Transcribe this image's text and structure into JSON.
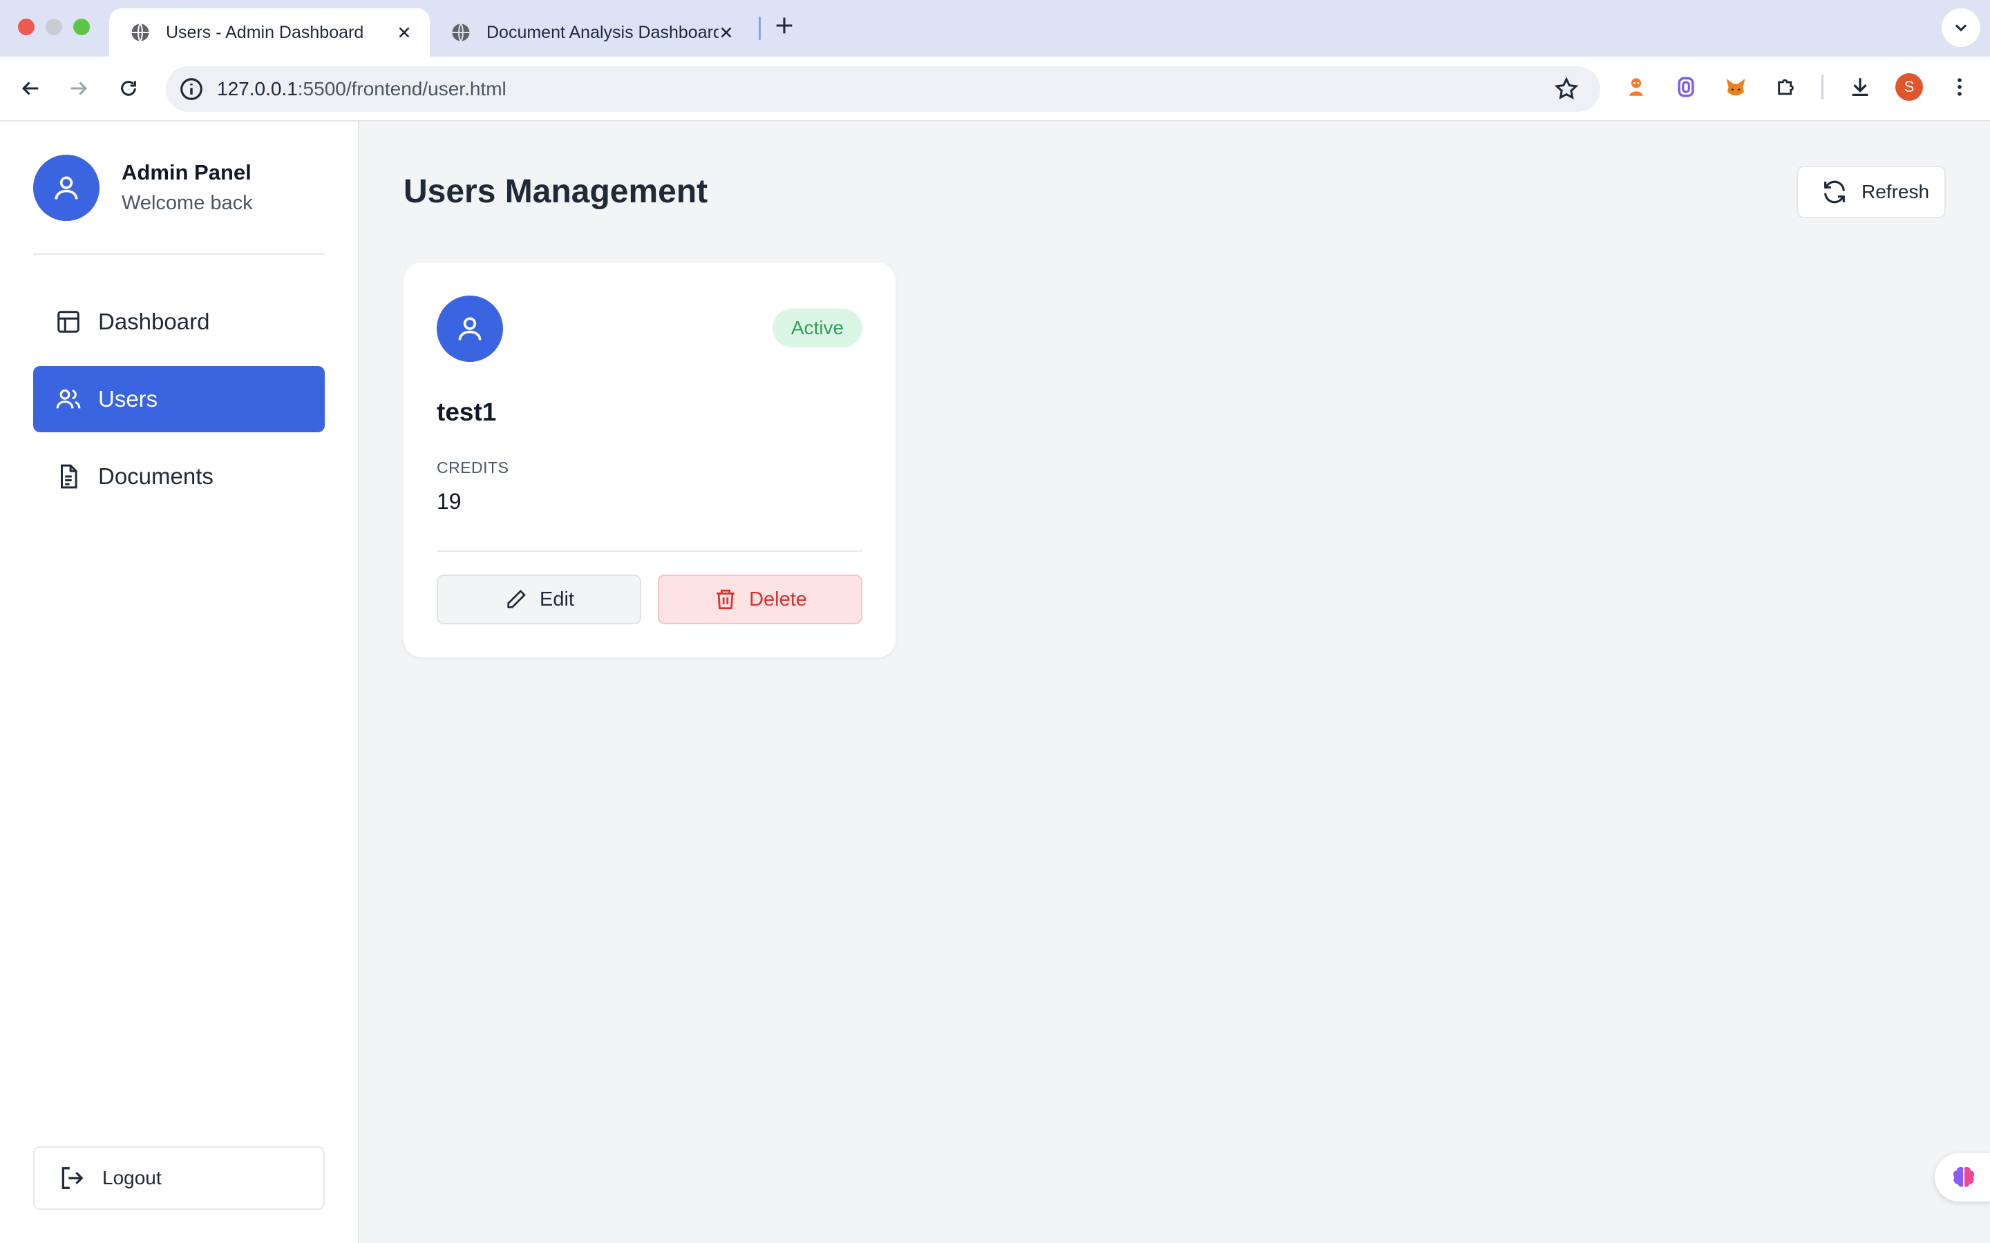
{
  "browser": {
    "tabs": [
      {
        "title": "Users - Admin Dashboard",
        "active": true
      },
      {
        "title": "Document Analysis Dashboard",
        "active": false
      }
    ],
    "url_host": "127.0.0.1",
    "url_rest": ":5500/frontend/user.html",
    "profile_initial": "S"
  },
  "sidebar": {
    "title": "Admin Panel",
    "subtitle": "Welcome back",
    "items": [
      {
        "label": "Dashboard",
        "icon": "layout-icon"
      },
      {
        "label": "Users",
        "icon": "users-icon",
        "active": true
      },
      {
        "label": "Documents",
        "icon": "document-icon"
      }
    ],
    "logout_label": "Logout"
  },
  "main": {
    "title": "Users Management",
    "refresh_label": "Refresh",
    "users": [
      {
        "name": "test1",
        "status": "Active",
        "credits_label": "CREDITS",
        "credits": "19",
        "edit_label": "Edit",
        "delete_label": "Delete"
      }
    ]
  },
  "colors": {
    "accent": "#3b64e0",
    "active_badge_bg": "#dcf6e6",
    "active_badge_text": "#2e9e5b",
    "delete_bg": "#fde3e3",
    "delete_text": "#dc2f2f"
  }
}
